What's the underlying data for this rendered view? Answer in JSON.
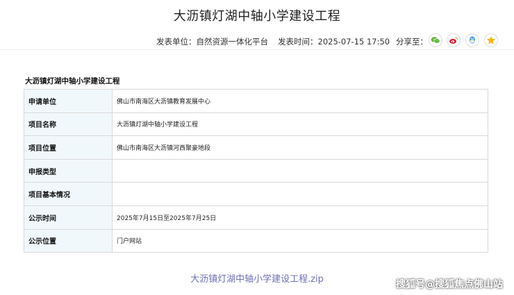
{
  "article": {
    "title": "大沥镇灯湖中轴小学建设工程",
    "publisher": "发表单位：自然资源一体化平台",
    "publish_time": "发表时间：2025-07-15 17:50",
    "share_label": "分享至："
  },
  "share": {
    "buttons": [
      {
        "icon": "wechat-icon",
        "color": "#5cb531"
      },
      {
        "icon": "weibo-icon",
        "color": "#e6162d"
      },
      {
        "icon": "qq-icon",
        "color": "#3f9ae8"
      },
      {
        "icon": "qzone-icon",
        "color": "#f5b400"
      }
    ]
  },
  "project": {
    "heading": "大沥镇灯湖中轴小学建设工程",
    "rows": [
      {
        "label": "申请单位",
        "value": "佛山市南海区大沥镇教育发展中心"
      },
      {
        "label": "项目名称",
        "value": "大沥镇灯湖中轴小学建设工程"
      },
      {
        "label": "项目位置",
        "value": "佛山市南海区大沥镇河西聚豪地段"
      },
      {
        "label": "申报类型",
        "value": ""
      },
      {
        "label": "项目基本情况",
        "value": ""
      },
      {
        "label": "公示时间",
        "value": "2025年7月15日至2025年7月25日"
      },
      {
        "label": "公示位置",
        "value": "门户网站"
      }
    ]
  },
  "attachment": {
    "filename": "大沥镇灯湖中轴小学建设工程.zip"
  },
  "watermark": {
    "text": "搜狐号@搜狐焦点佛山站"
  }
}
